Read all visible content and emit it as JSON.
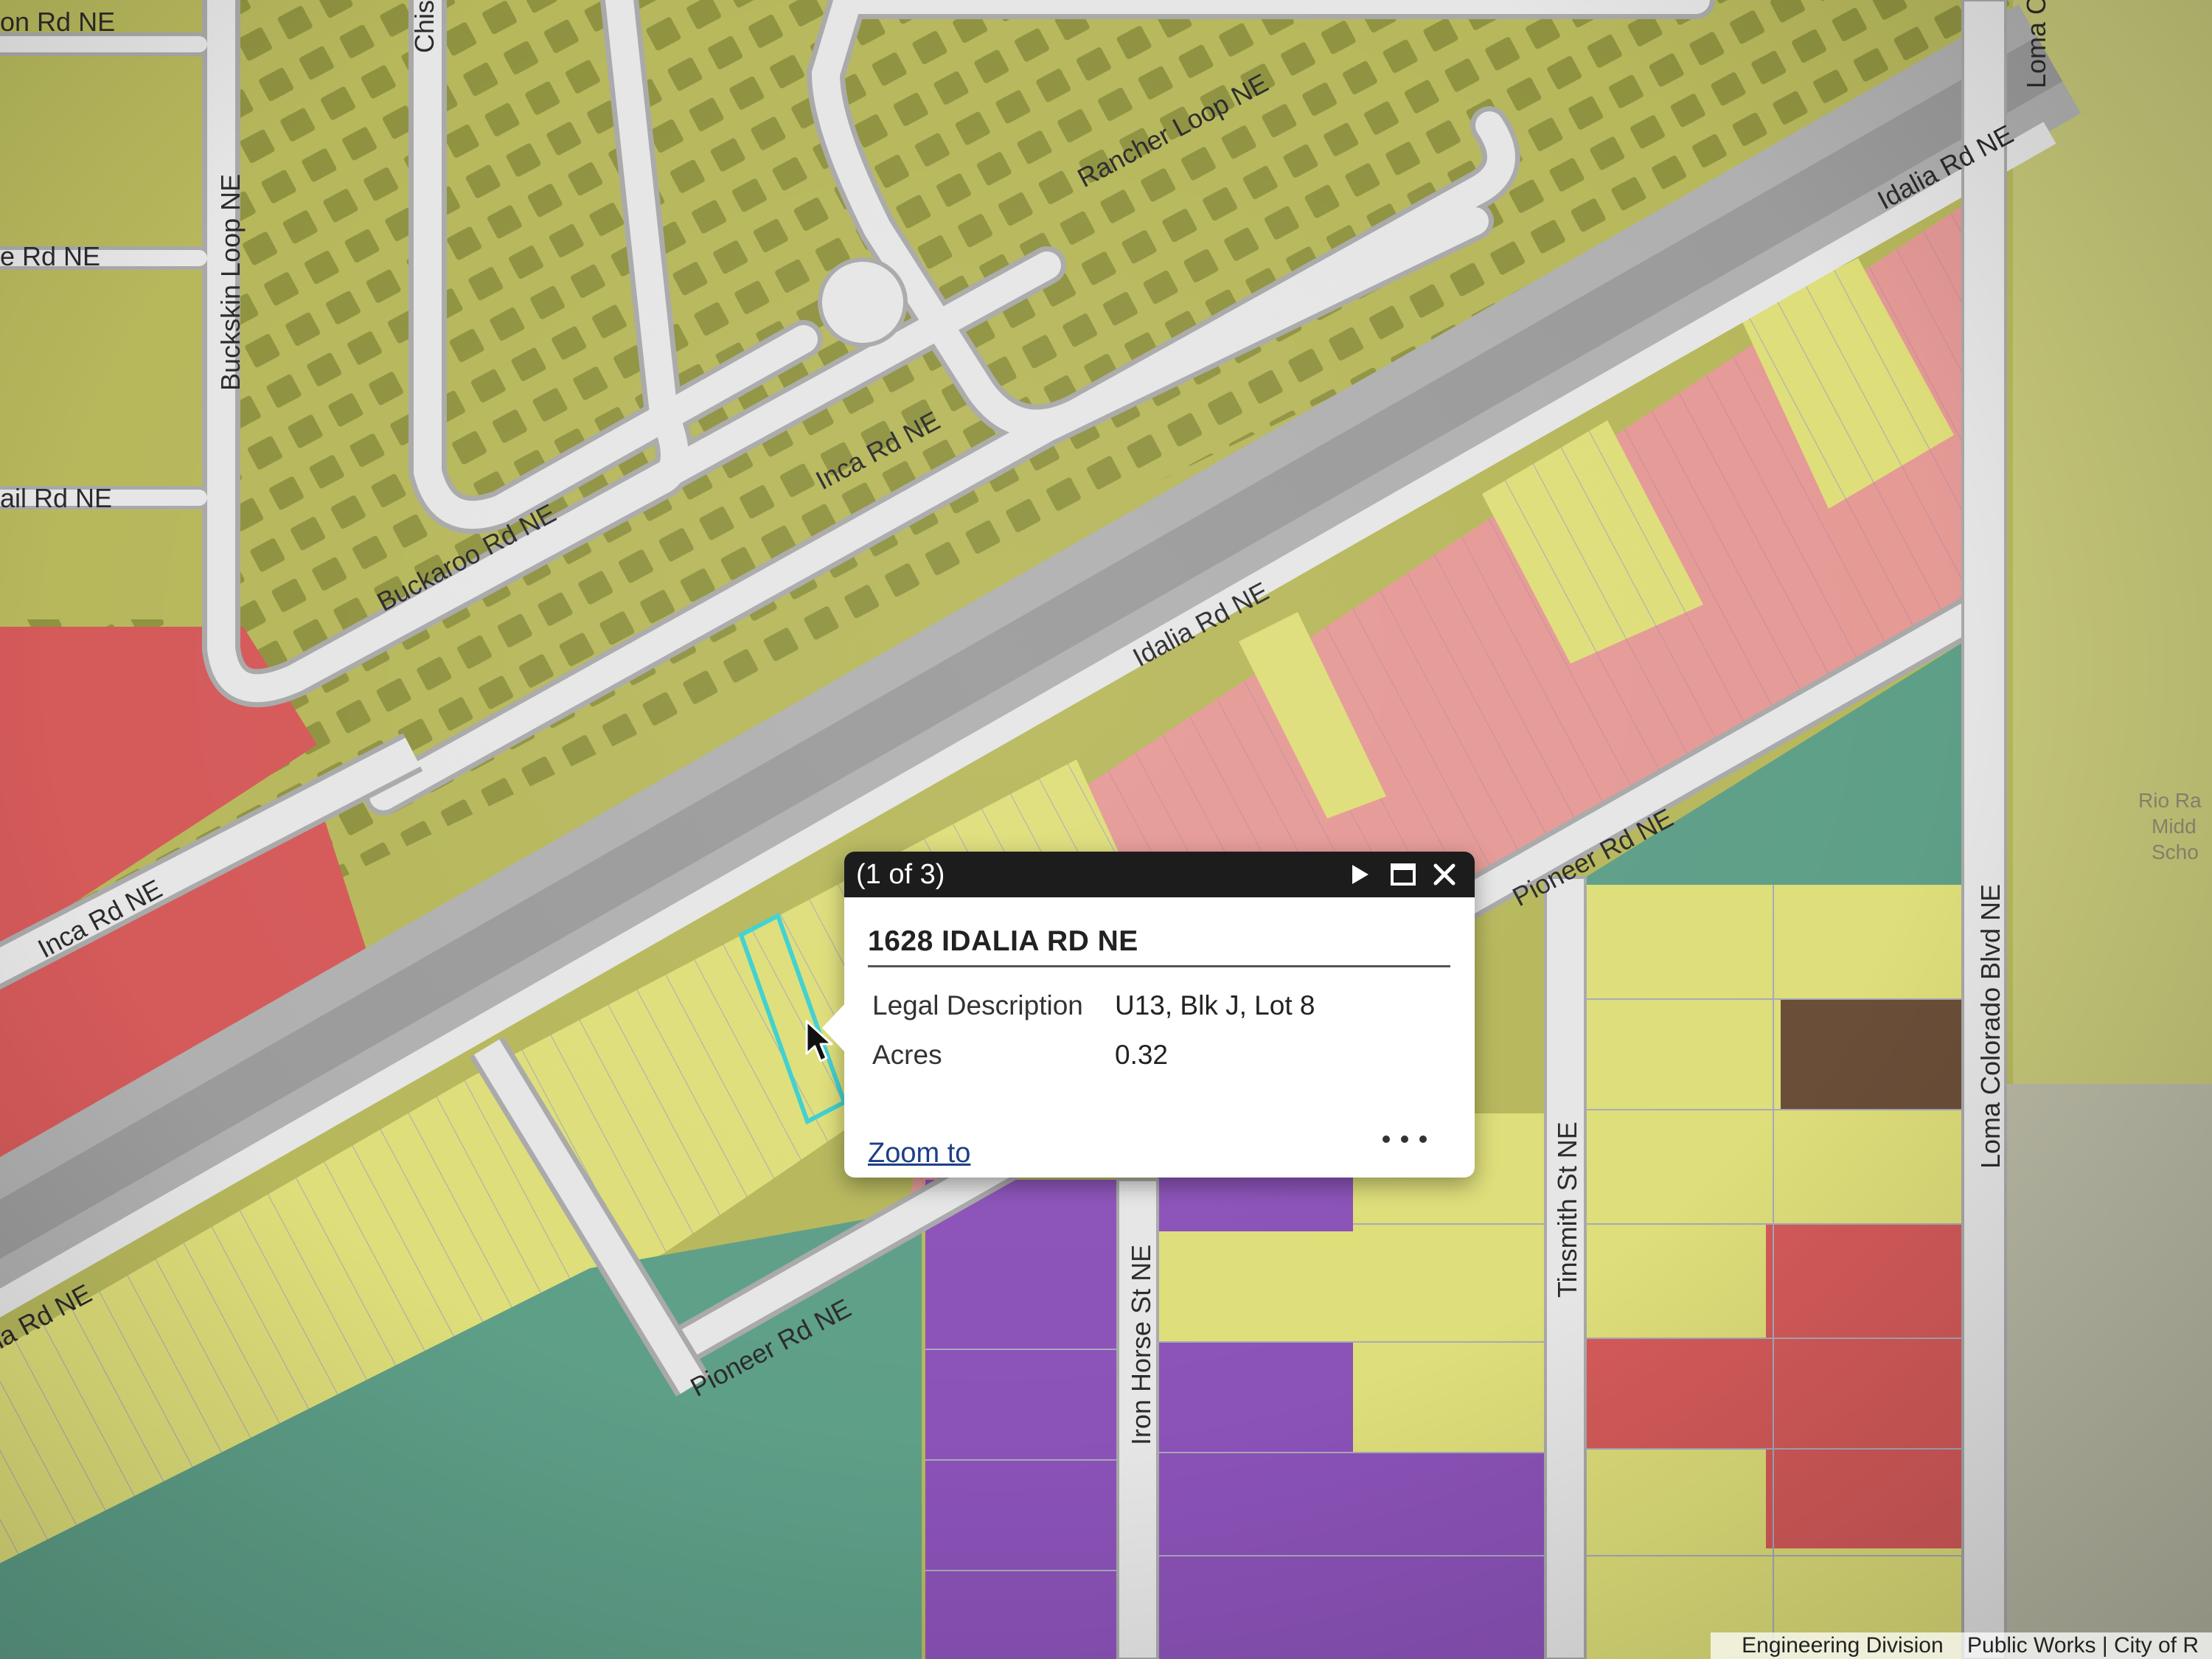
{
  "map": {
    "road_labels": [
      "Rancher Loop NE",
      "Idalia Rd NE",
      "Inca Rd NE",
      "Buckaroo Rd NE",
      "Buckskin Loop NE",
      "Idalia Rd NE",
      "Inca Rd NE",
      "Pioneer Rd NE",
      "Pioneer Rd NE",
      "Iron Horse St NE",
      "Tinsmith St NE",
      "Loma Colorado Blvd NE",
      "on Rd NE",
      "e Rd NE",
      "ail Rd NE",
      "Chis",
      "ia Rd NE",
      "Loma C"
    ],
    "poi_label_lines": [
      "Rio Ra",
      "Midd",
      "Scho"
    ],
    "attribution_parts": [
      "Engineering Division",
      "Public Works | City of R"
    ]
  },
  "popup": {
    "count": "(1 of 3)",
    "title": "1628 IDALIA RD NE",
    "fields": [
      {
        "label": "Legal Description",
        "value": "U13, Blk J, Lot 8"
      },
      {
        "label": "Acres",
        "value": "0.32"
      }
    ],
    "zoom_link": "Zoom to",
    "icons": {
      "next": "play-icon",
      "maximize": "maximize-icon",
      "close": "close-icon",
      "more": "more-icon"
    }
  },
  "colors": {
    "residential_olive": "#b7b85c",
    "house_footprint": "#8f9340",
    "low_density_yellow": "#dede7a",
    "commercial_pink": "#e59a96",
    "commercial_red": "#d55a5a",
    "open_space_teal": "#5e9f88",
    "public_purple": "#8b52b8",
    "road_fill": "#e6e6e6",
    "road_edge": "#a9a9a9",
    "highlight_cyan": "#3ed0cf",
    "popup_header": "#1c1c1c"
  }
}
